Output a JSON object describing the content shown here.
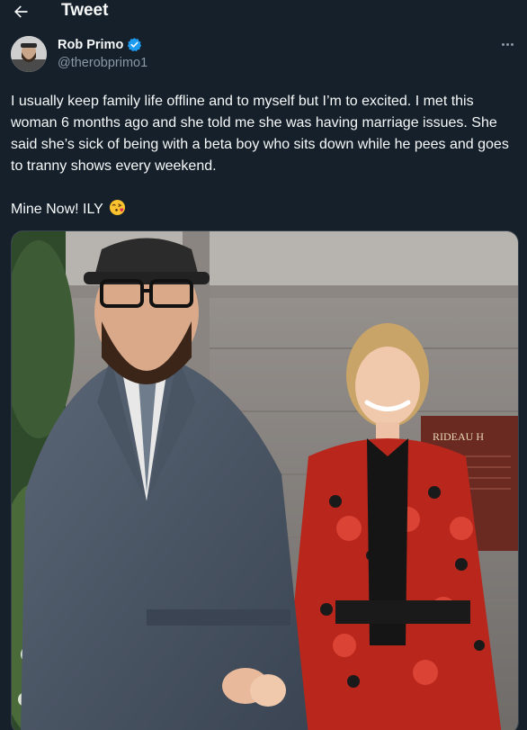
{
  "header": {
    "title": "Tweet",
    "back_icon": "arrow-left-icon"
  },
  "author": {
    "name": "Rob Primo",
    "handle": "@therobprimo1",
    "verified_icon": "verified-badge-icon",
    "verified_color": "#1d9bf0"
  },
  "tweet": {
    "paragraph1": "I usually keep family life offline and to myself but I’m to excited. I met this woman 6 months ago and she told me she was having marriage issues. She said she’s sick of being with a beta boy who sits down while he pees and goes to tranny shows every weekend.",
    "paragraph2": "Mine Now! ILY",
    "emoji": "face-blowing-kiss-icon"
  },
  "media": {
    "sign_text": "RIDEAU H"
  },
  "colors": {
    "background": "#15202b",
    "text_primary": "#f7f9f9",
    "text_secondary": "#8b98a5",
    "border": "#38444d"
  }
}
